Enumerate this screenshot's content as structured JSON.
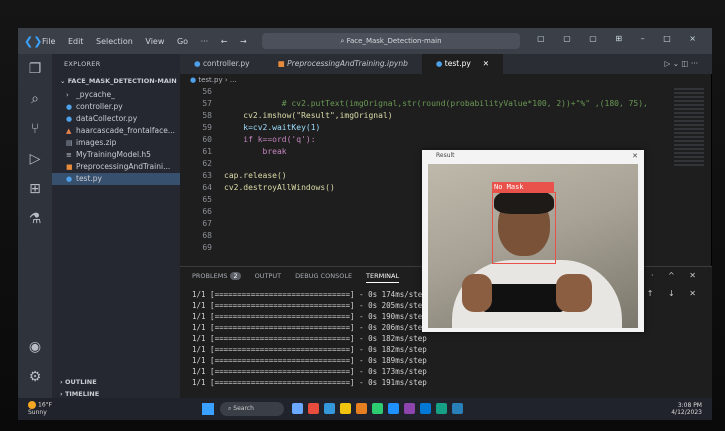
{
  "window": {
    "search_text": "Face_Mask_Detection-main",
    "menu": [
      "File",
      "Edit",
      "Selection",
      "View",
      "Go"
    ],
    "controls": "▢ ▢ ▢ ⊞  –  □  ×"
  },
  "sidebar": {
    "header": "EXPLORER",
    "project": "FACE_MASK_DETECTION-MAIN",
    "files": [
      {
        "label": "_pycache_",
        "icon": "›"
      },
      {
        "label": "controller.py",
        "icon": "●"
      },
      {
        "label": "dataCollector.py",
        "icon": "●"
      },
      {
        "label": "haarcascade_frontalface...",
        "icon": "▲"
      },
      {
        "label": "images.zip",
        "icon": "▤"
      },
      {
        "label": "MyTrainingModel.h5",
        "icon": "≡"
      },
      {
        "label": "PreprocessingAndTraini...",
        "icon": "■"
      },
      {
        "label": "test.py",
        "icon": "●"
      }
    ],
    "outline": "OUTLINE",
    "timeline": "TIMELINE"
  },
  "tabs": [
    {
      "label": "controller.py"
    },
    {
      "label": "PreprocessingAndTraining.ipynb"
    },
    {
      "label": "test.py"
    }
  ],
  "breadcrumb": "test.py › ...",
  "code": [
    {
      "n": "56",
      "t": ""
    },
    {
      "n": "57",
      "t": "            # cv2.putText(imgOrignal,str(round(probabilityValue*100, 2))+\"%\" ,(180, 75),"
    },
    {
      "n": "58",
      "t": "    cv2.imshow(\"Result\",imgOrignal)"
    },
    {
      "n": "59",
      "t": "    k=cv2.waitKey(1)"
    },
    {
      "n": "60",
      "t": "    if k==ord('q'):"
    },
    {
      "n": "61",
      "t": "        break"
    },
    {
      "n": "62",
      "t": ""
    },
    {
      "n": "63",
      "t": "cap.release()"
    },
    {
      "n": "64",
      "t": "cv2.destroyAllWindows()"
    },
    {
      "n": "65",
      "t": ""
    },
    {
      "n": "66",
      "t": ""
    },
    {
      "n": "67",
      "t": ""
    },
    {
      "n": "68",
      "t": ""
    },
    {
      "n": "69",
      "t": ""
    }
  ],
  "panel": {
    "tabs": [
      "PROBLEMS",
      "OUTPUT",
      "DEBUG CONSOLE",
      "TERMINAL"
    ],
    "problems_count": "2",
    "terminal": [
      "1/1 [==============================] - 0s 174ms/step",
      "1/1 [==============================] - 0s 205ms/step",
      "1/1 [==============================] - 0s 190ms/step",
      "1/1 [==============================] - 0s 206ms/step",
      "1/1 [==============================] - 0s 182ms/step",
      "1/1 [==============================] - 0s 182ms/step",
      "1/1 [==============================] - 0s 189ms/step",
      "1/1 [==============================] - 0s 173ms/step",
      "1/1 [==============================] - 0s 191ms/step"
    ]
  },
  "camera": {
    "title": "Result",
    "label": "No Mask"
  },
  "taskbar": {
    "weather_temp": "16°F",
    "weather_text": "Sunny",
    "search": "Search",
    "time": "3:08 PM",
    "date": "4/12/2023"
  },
  "colors": {
    "accent": "#3aa3ff",
    "no_mask_box": "#e9524b"
  }
}
